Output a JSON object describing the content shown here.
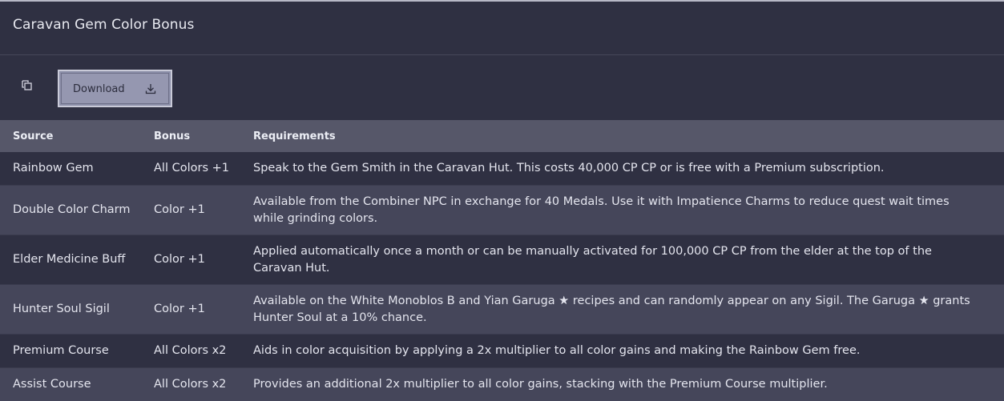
{
  "panel": {
    "title": "Caravan Gem Color Bonus"
  },
  "toolbar": {
    "copy_icon": "copy-icon",
    "download_label": "Download",
    "download_icon": "download-icon"
  },
  "table": {
    "columns": [
      "Source",
      "Bonus",
      "Requirements"
    ],
    "rows": [
      {
        "source": "Rainbow Gem",
        "bonus": "All Colors +1",
        "requirements": "Speak to the Gem Smith in the Caravan Hut. This costs 40,000 CP CP or is free with a Premium subscription."
      },
      {
        "source": "Double Color Charm",
        "bonus": "Color +1",
        "requirements": "Available from the Combiner NPC in exchange for 40 Medals. Use it with Impatience Charms to reduce quest wait times while grinding colors."
      },
      {
        "source": "Elder Medicine Buff",
        "bonus": "Color +1",
        "requirements": "Applied automatically once a month or can be manually activated for 100,000 CP CP from the elder at the top of the Caravan Hut."
      },
      {
        "source": "Hunter Soul Sigil",
        "bonus": "Color +1",
        "requirements": "Available on the White Monoblos B and Yian Garuga ★ recipes and can randomly appear on any Sigil. The Garuga ★ grants Hunter Soul at a 10% chance."
      },
      {
        "source": "Premium Course",
        "bonus": "All Colors x2",
        "requirements": "Aids in color acquisition by applying a 2x multiplier to all color gains and making the Rainbow Gem free."
      },
      {
        "source": "Assist Course",
        "bonus": "All Colors x2",
        "requirements": "Provides an additional 2x multiplier to all color gains, stacking with the Premium Course multiplier."
      }
    ]
  },
  "colors": {
    "background": "#2f3042",
    "header_row": "#565769",
    "striped_row": "#45465a",
    "button_fill": "#9597b0"
  }
}
